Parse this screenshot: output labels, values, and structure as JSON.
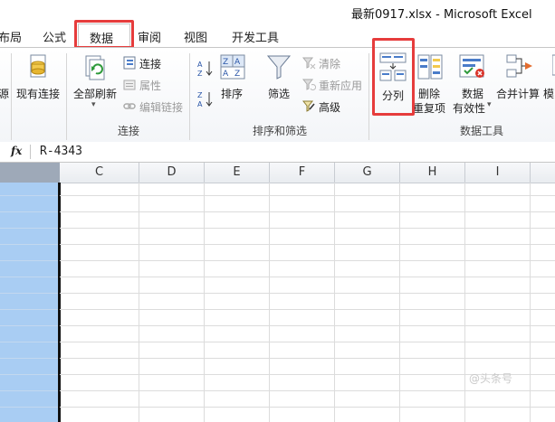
{
  "window": {
    "title": "最新0917.xlsx  -  Microsoft Excel"
  },
  "tabs": [
    {
      "label": "布局"
    },
    {
      "label": "公式"
    },
    {
      "label": "数据"
    },
    {
      "label": "审阅"
    },
    {
      "label": "视图"
    },
    {
      "label": "开发工具"
    }
  ],
  "ribbon": {
    "ext_data": {
      "partial_label": "源",
      "existing_connections": "现有连接"
    },
    "connections": {
      "refresh_all": "全部刷新",
      "connections": "连接",
      "properties": "属性",
      "edit_links": "编辑链接",
      "group_label": "连接"
    },
    "sort_filter": {
      "sort": "排序",
      "filter": "筛选",
      "clear": "清除",
      "reapply": "重新应用",
      "advanced": "高级",
      "group_label": "排序和筛选"
    },
    "data_tools": {
      "text_to_columns": "分列",
      "remove_duplicates_l1": "删除",
      "remove_duplicates_l2": "重复项",
      "data_validation_l1": "数据",
      "data_validation_l2": "有效性",
      "consolidate": "合并计算",
      "whatif_partial": "模",
      "group_label": "数据工具"
    }
  },
  "formula_bar": {
    "fx": "fx",
    "value": "R-4343"
  },
  "grid": {
    "columns": [
      "C",
      "D",
      "E",
      "F",
      "G",
      "H",
      "I"
    ]
  },
  "watermark": "@头条号"
}
